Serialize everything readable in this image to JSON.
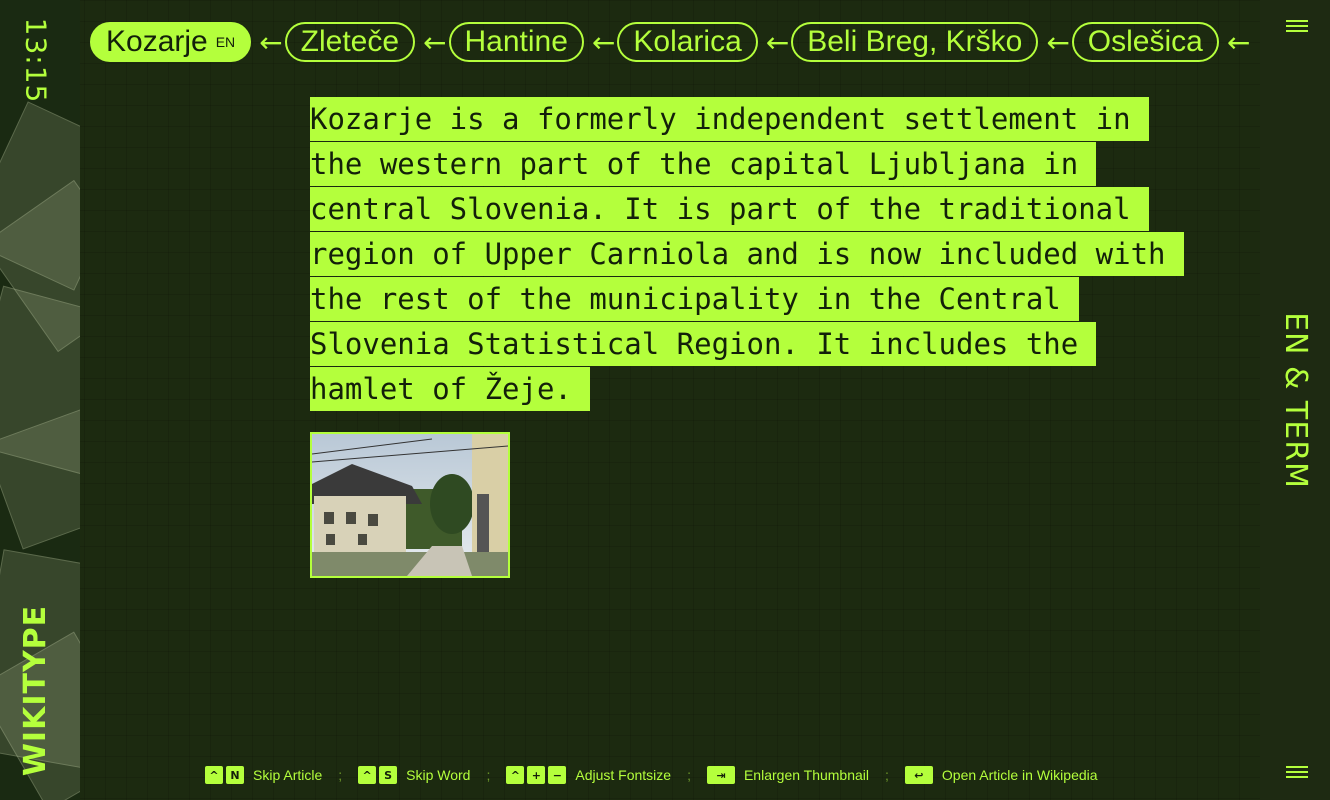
{
  "colors": {
    "accent": "#b4ff3c",
    "background": "#1c2a10",
    "text_on_accent": "#13200a"
  },
  "clock": "13:15",
  "brand": "WIKITYPE",
  "side_label": "EN & TERM",
  "breadcrumb": {
    "current": {
      "label": "Kozarje",
      "lang": "EN"
    },
    "arrow": "←",
    "history": [
      "Zleteče",
      "Hantine",
      "Kolarica",
      "Beli Breg, Krško",
      "Oslešica"
    ]
  },
  "article": {
    "text": "Kozarje is a formerly independent settlement in the western part of the capital Ljubljana in central Slovenia. It is part of the traditional region of Upper Carniola and is now included with the rest of the municipality in the Central Slovenia Statistical Region. It includes the hamlet of Žeje."
  },
  "footer": {
    "separator": ";",
    "hints": [
      {
        "keys": [
          "^",
          "N"
        ],
        "label": "Skip Article"
      },
      {
        "keys": [
          "^",
          "S"
        ],
        "label": "Skip Word"
      },
      {
        "keys": [
          "^",
          "+",
          "−"
        ],
        "label": "Adjust Fontsize"
      },
      {
        "keys": [
          "⇥"
        ],
        "label": "Enlargen Thumbnail"
      },
      {
        "keys": [
          "↩"
        ],
        "label": "Open Article in Wikipedia"
      }
    ]
  },
  "icons": [
    "menu-icon",
    "arrow-left-icon"
  ]
}
